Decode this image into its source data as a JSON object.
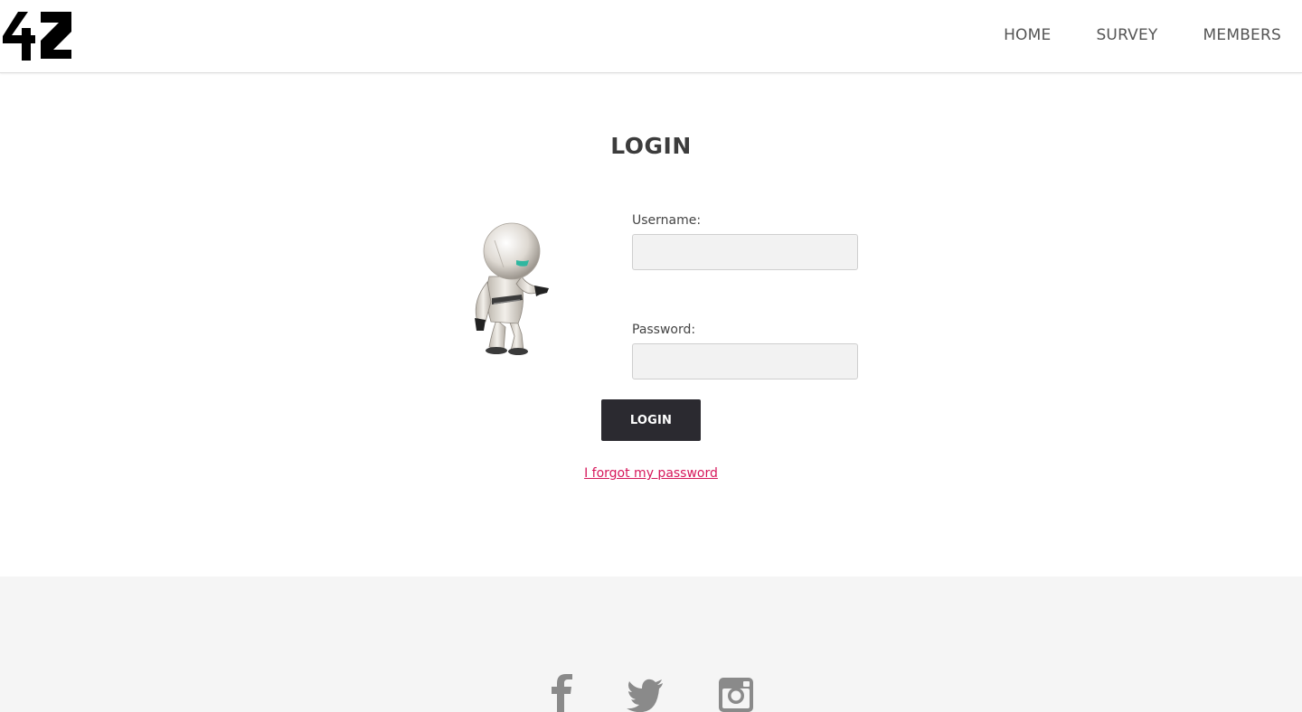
{
  "header": {
    "logo_text": "42",
    "nav": [
      {
        "label": "HOME"
      },
      {
        "label": "SURVEY"
      },
      {
        "label": "MEMBERS"
      }
    ]
  },
  "main": {
    "title": "LOGIN",
    "username_label": "Username:",
    "username_value": "",
    "password_label": "Password:",
    "password_value": "",
    "login_button": "LOGIN",
    "forgot_link": "I forgot my password"
  },
  "footer": {
    "social_icons": [
      "facebook-icon",
      "twitter-icon",
      "instagram-icon"
    ]
  },
  "colors": {
    "button_bg": "#2b2a30",
    "link": "#d6175b",
    "footer_bg": "#f5f5f5",
    "icon_gray": "#8a8a8a"
  }
}
